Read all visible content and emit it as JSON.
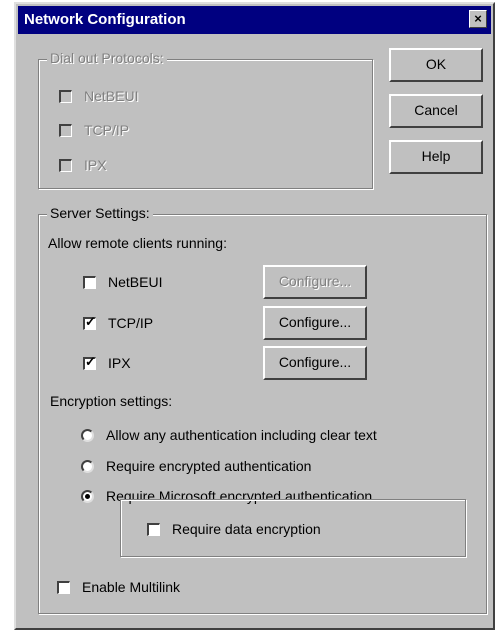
{
  "dialog": {
    "title": "Network Configuration",
    "close_glyph": "×"
  },
  "dial_out": {
    "legend": "Dial out Protocols:",
    "options": [
      {
        "label": "NetBEUI",
        "checked": false,
        "enabled": false
      },
      {
        "label": "TCP/IP",
        "checked": false,
        "enabled": false
      },
      {
        "label": "IPX",
        "checked": false,
        "enabled": false
      }
    ]
  },
  "buttons": {
    "ok": "OK",
    "cancel": "Cancel",
    "help": "Help"
  },
  "server": {
    "legend": "Server Settings:",
    "allow_label": "Allow remote clients running:",
    "protocols": [
      {
        "label": "NetBEUI",
        "checked": false,
        "configure_label": "Configure...",
        "configure_enabled": false
      },
      {
        "label": "TCP/IP",
        "checked": true,
        "configure_label": "Configure...",
        "configure_enabled": true
      },
      {
        "label": "IPX",
        "checked": true,
        "configure_label": "Configure...",
        "configure_enabled": true
      }
    ],
    "encryption_label": "Encryption settings:",
    "encryption_options": [
      {
        "label": "Allow any authentication including clear text",
        "selected": false
      },
      {
        "label": "Require encrypted authentication",
        "selected": false
      },
      {
        "label": "Require Microsoft encrypted authentication",
        "selected": true
      }
    ],
    "data_encryption": {
      "label": "Require data encryption",
      "checked": false
    },
    "multilink": {
      "label": "Enable Multilink",
      "checked": false
    }
  },
  "icons": {
    "check": "✓"
  }
}
